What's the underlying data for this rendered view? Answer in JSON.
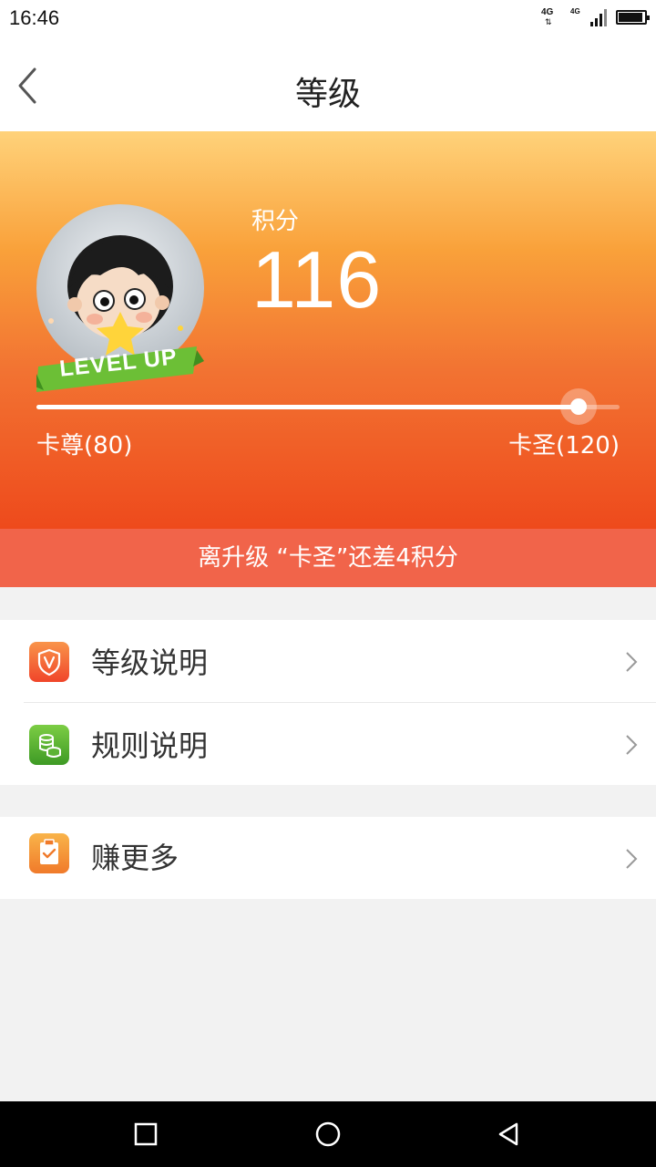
{
  "status_bar": {
    "time": "16:46",
    "network_1": "4G",
    "network_2": "4G",
    "battery_level": 0.9
  },
  "header": {
    "title": "等级",
    "back_icon": "chevron-left-icon"
  },
  "hero": {
    "points_label": "积分",
    "points_value": "116",
    "badge_text": "LEVEL UP",
    "avatar_icon": "cartoon-avatar",
    "progress_fraction": 0.93,
    "current_level": "卡尊(80)",
    "next_level": "卡圣(120)",
    "gradient_top": "#ffd27a",
    "gradient_bottom": "#ee4a1c"
  },
  "notice": {
    "text": "离升级 “卡圣”还差4积分",
    "color": "#f1644a"
  },
  "menu": {
    "group1": [
      {
        "label": "等级说明",
        "icon": "shield-v-icon",
        "color": "#f4622d"
      },
      {
        "label": "规则说明",
        "icon": "coins-icon",
        "color": "#5cb335"
      }
    ],
    "group2": [
      {
        "label": "赚更多",
        "icon": "clipboard-check-icon",
        "color": "#f68a2c"
      }
    ]
  },
  "nav_bar": {
    "recent_icon": "square-icon",
    "home_icon": "circle-icon",
    "back_icon": "triangle-back-icon"
  }
}
